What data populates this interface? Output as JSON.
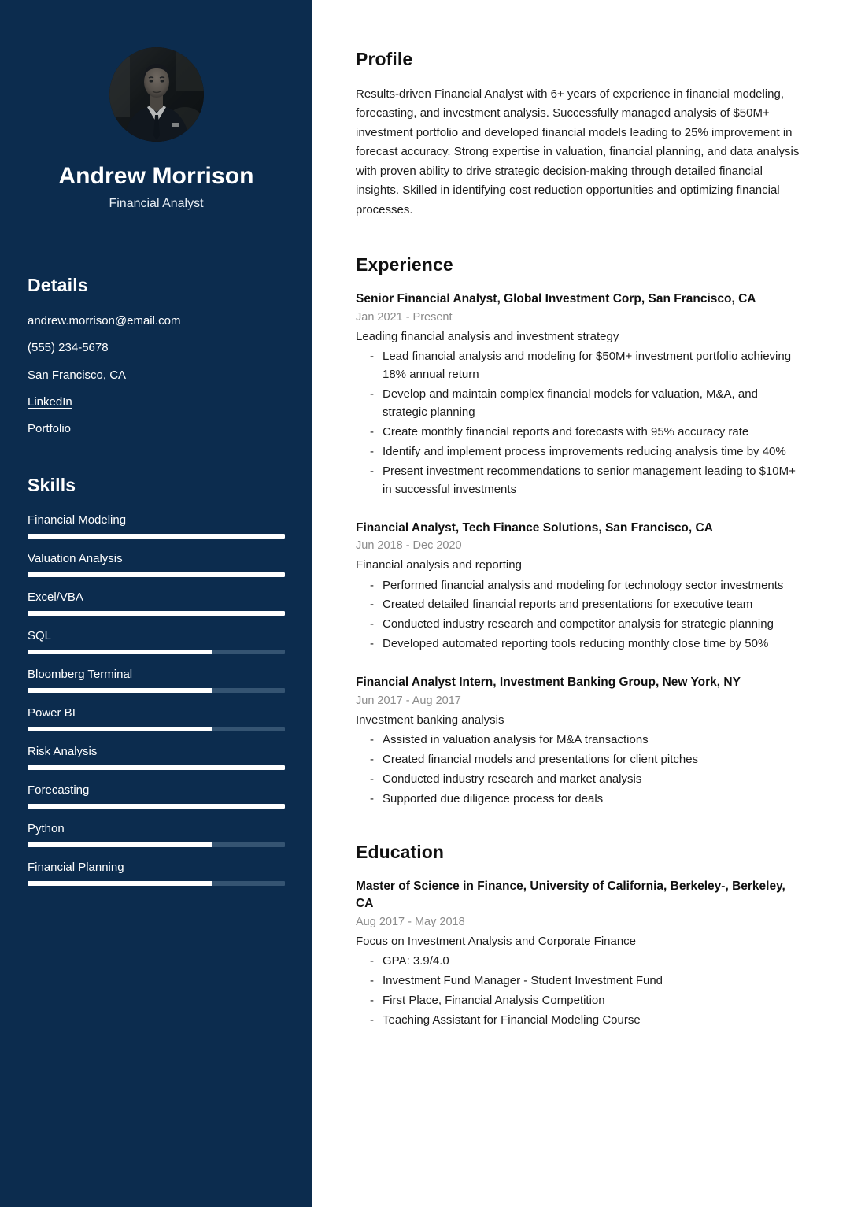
{
  "theme": {
    "sidebar_bg": "#0c2c4e",
    "sidebar_text": "#ffffff",
    "skill_track": "#355472",
    "skill_fill": "#ffffff",
    "divider": "#5c7d9d",
    "body_text": "#1c1c1c",
    "muted_text": "#8a8a8a"
  },
  "sidebar": {
    "avatar": "profile-photo",
    "name": "Andrew Morrison",
    "job_title": "Financial Analyst",
    "details_heading": "Details",
    "details": [
      {
        "text": "andrew.morrison@email.com",
        "link": false,
        "name": "email"
      },
      {
        "text": "(555) 234-5678",
        "link": false,
        "name": "phone"
      },
      {
        "text": "San Francisco, CA",
        "link": false,
        "name": "location"
      },
      {
        "text": "LinkedIn",
        "link": true,
        "name": "linkedin"
      },
      {
        "text": "Portfolio",
        "link": true,
        "name": "portfolio"
      }
    ],
    "skills_heading": "Skills",
    "skills": [
      {
        "label": "Financial Modeling",
        "level": 100
      },
      {
        "label": "Valuation Analysis",
        "level": 100
      },
      {
        "label": "Excel/VBA",
        "level": 100
      },
      {
        "label": "SQL",
        "level": 72
      },
      {
        "label": "Bloomberg Terminal",
        "level": 72
      },
      {
        "label": "Power BI",
        "level": 72
      },
      {
        "label": "Risk Analysis",
        "level": 100
      },
      {
        "label": "Forecasting",
        "level": 100
      },
      {
        "label": "Python",
        "level": 72
      },
      {
        "label": "Financial Planning",
        "level": 72
      }
    ]
  },
  "main": {
    "profile": {
      "heading": "Profile",
      "text": "Results-driven Financial Analyst with 6+ years of experience in financial modeling, forecasting, and investment analysis. Successfully managed analysis of $50M+ investment portfolio and developed financial models leading to 25% improvement in forecast accuracy. Strong expertise in valuation, financial planning, and data analysis with proven ability to drive strategic decision-making through detailed financial insights. Skilled in identifying cost reduction opportunities and optimizing financial processes."
    },
    "experience": {
      "heading": "Experience",
      "entries": [
        {
          "title": "Senior Financial Analyst, Global Investment Corp, San Francisco, CA",
          "dates": "Jan 2021 - Present",
          "summary": "Leading financial analysis and investment strategy",
          "bullets": [
            "Lead financial analysis and modeling for $50M+ investment portfolio achieving 18% annual return",
            "Develop and maintain complex financial models for valuation, M&A, and strategic planning",
            "Create monthly financial reports and forecasts with 95% accuracy rate",
            "Identify and implement process improvements reducing analysis time by 40%",
            "Present investment recommendations to senior management leading to $10M+ in successful investments"
          ]
        },
        {
          "title": "Financial Analyst, Tech Finance Solutions, San Francisco, CA",
          "dates": "Jun 2018 - Dec 2020",
          "summary": "Financial analysis and reporting",
          "bullets": [
            "Performed financial analysis and modeling for technology sector investments",
            "Created detailed financial reports and presentations for executive team",
            "Conducted industry research and competitor analysis for strategic planning",
            "Developed automated reporting tools reducing monthly close time by 50%"
          ]
        },
        {
          "title": "Financial Analyst Intern, Investment Banking Group, New York, NY",
          "dates": "Jun 2017 - Aug 2017",
          "summary": "Investment banking analysis",
          "bullets": [
            "Assisted in valuation analysis for M&A transactions",
            "Created financial models and presentations for client pitches",
            "Conducted industry research and market analysis",
            "Supported due diligence process for deals"
          ]
        }
      ]
    },
    "education": {
      "heading": "Education",
      "entries": [
        {
          "title": "Master of Science in Finance, University of California, Berkeley-, Berkeley, CA",
          "dates": "Aug 2017 - May 2018",
          "summary": "Focus on Investment Analysis and Corporate Finance",
          "bullets": [
            "GPA: 3.9/4.0",
            "Investment Fund Manager - Student Investment Fund",
            "First Place, Financial Analysis Competition",
            "Teaching Assistant for Financial Modeling Course"
          ]
        }
      ]
    }
  }
}
